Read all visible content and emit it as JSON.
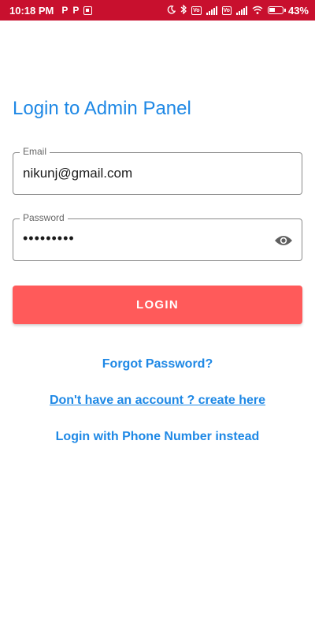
{
  "status_bar": {
    "time": "10:18 PM",
    "battery_percent": "43%",
    "left_icons": [
      "p-icon",
      "p-icon",
      "notification-box-icon"
    ],
    "right_icons": [
      "moon-icon",
      "bluetooth-icon",
      "volte-icon",
      "signal-icon",
      "volte-icon",
      "signal-icon",
      "wifi-icon",
      "battery-icon"
    ],
    "background_color": "#c8102e"
  },
  "header": {
    "title": "Login to Admin Panel"
  },
  "form": {
    "email": {
      "label": "Email",
      "value": "nikunj@gmail.com"
    },
    "password": {
      "label": "Password",
      "value": "•••••••••",
      "toggle_icon": "eye-icon"
    },
    "login_button_label": "LOGIN"
  },
  "links": {
    "forgot_password": "Forgot Password?",
    "create_account": "Don't have an account ? create here",
    "phone_login": "Login with Phone Number instead"
  },
  "colors": {
    "accent": "#1e88e5",
    "button": "#ff5a5a"
  }
}
